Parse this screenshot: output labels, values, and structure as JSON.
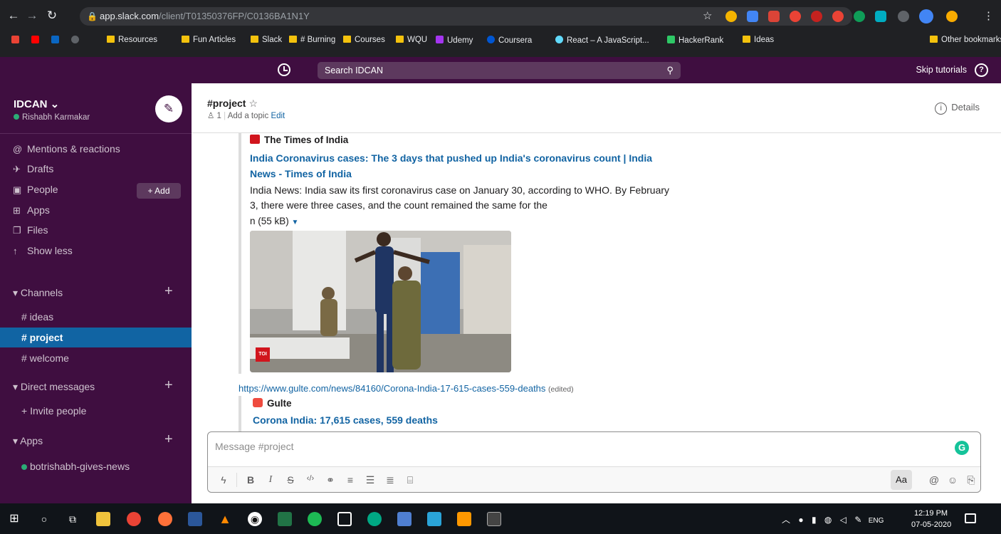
{
  "browser": {
    "url_host": "app.slack.com",
    "url_path": "/client/T01350376FP/C0136BA1N1Y",
    "bookmarks": [
      "Resources",
      "Fun Articles",
      "Slack",
      "# Burning",
      "Courses",
      "WQU",
      "Udemy",
      "Coursera",
      "React – A JavaScript...",
      "HackerRank",
      "Ideas",
      "Other bookmarks"
    ]
  },
  "topbar": {
    "search_label": "Search IDCAN",
    "skip_label": "Skip tutorials",
    "help_glyph": "?"
  },
  "workspace": {
    "name": "IDCAN ⌄",
    "user": "Rishabh Karmakar",
    "compose_glyph": "✎"
  },
  "nav": {
    "mentions": "Mentions & reactions",
    "drafts": "Drafts",
    "people": "People",
    "add": "+ Add",
    "apps": "Apps",
    "files": "Files",
    "show_less": "Show less"
  },
  "channels": {
    "header": "Channels",
    "items": [
      "# ideas",
      "# project",
      "# welcome"
    ]
  },
  "dms": {
    "header": "Direct messages",
    "invite": "+ Invite people"
  },
  "apps_section": {
    "header": "Apps",
    "bot": "botrishabh-gives-news"
  },
  "channel": {
    "title": "#project",
    "members": "1",
    "add_topic": "Add a topic",
    "edit": "Edit",
    "details": "Details"
  },
  "messages": {
    "attach1": {
      "source": "The Times of India",
      "link": "India Coronavirus cases: The 3 days that pushed up India's coronavirus count | India News - Times of India",
      "description": "India News: India saw its first coronavirus case on January 30, according to WHO. By February 3, there were three cases, and the count remained the same for the",
      "size": "n (55 kB)",
      "badge": "TOI"
    },
    "url2": "https://www.gulte.com/news/84160/Corona-India-17-615-cases-559-deaths",
    "edited": "(edited)",
    "attach2": {
      "source": "Gulte",
      "link": "Corona India: 17,615 cases, 559 deaths"
    }
  },
  "composer": {
    "placeholder": "Message #project",
    "aa": "Aa"
  },
  "taskbar": {
    "lang": "ENG",
    "time": "12:19 PM",
    "date": "07-05-2020"
  },
  "colors": {
    "sidebar": "#3f0e40",
    "active_channel": "#1164a3",
    "link": "#1264a3",
    "presence": "#2bac76"
  }
}
